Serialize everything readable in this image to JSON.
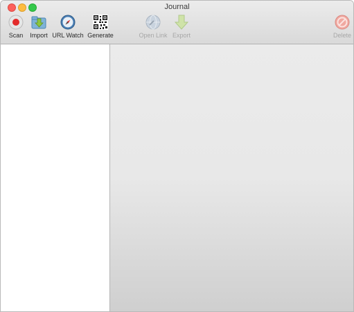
{
  "window": {
    "title": "Journal"
  },
  "toolbar": {
    "scan": {
      "label": "Scan",
      "icon": "record-icon"
    },
    "import": {
      "label": "Import",
      "icon": "folder-import-icon"
    },
    "url_watch": {
      "label": "URL Watch",
      "icon": "compass-icon"
    },
    "generate": {
      "label": "Generate",
      "icon": "qr-code-icon"
    },
    "open_link": {
      "label": "Open Link",
      "icon": "globe-link-icon",
      "enabled": false
    },
    "export": {
      "label": "Export",
      "icon": "arrow-down-icon",
      "enabled": false
    },
    "delete": {
      "label": "Delete",
      "icon": "no-entry-icon",
      "enabled": false
    }
  },
  "colors": {
    "close": "#fc605b",
    "minimize": "#fdbc40",
    "maximize": "#34c84a"
  }
}
